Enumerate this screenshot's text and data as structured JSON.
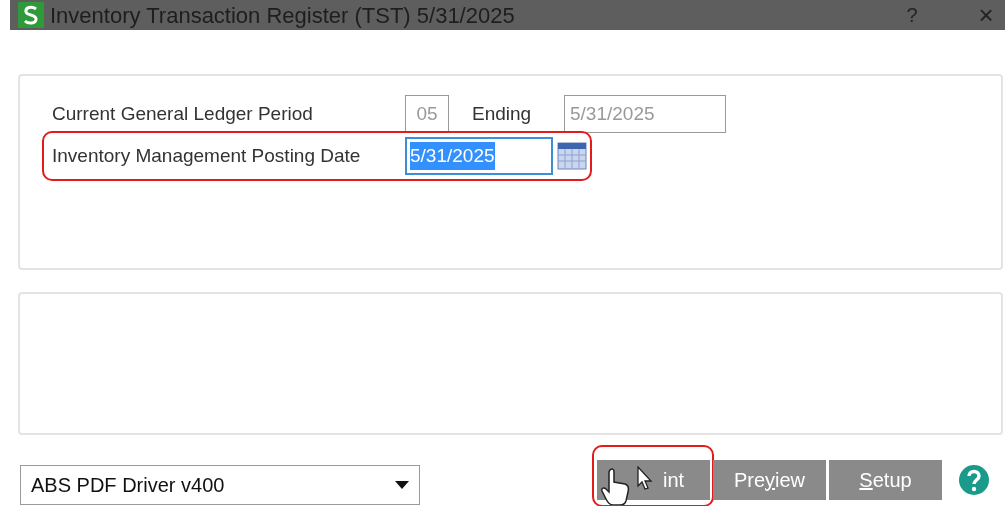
{
  "window": {
    "title": "Inventory Transaction Register (TST) 5/31/2025",
    "help": "?",
    "close": "×"
  },
  "fields": [
    {
      "kind": "period",
      "label": "Current General Ledger Period",
      "value": "05",
      "ending_label": "Ending",
      "ending_value": "5/31/2025"
    },
    {
      "kind": "date",
      "label": "Inventory Management Posting Date",
      "value": "5/31/2025",
      "selected": true,
      "highlight": true
    }
  ],
  "printer": {
    "value": "ABS PDF Driver v400"
  },
  "buttons": [
    {
      "after": "int",
      "highlight": true,
      "cursor": true
    },
    {
      "before": "Pre",
      "key": "y",
      "after": "iew"
    },
    {
      "key": "S",
      "after": "etup"
    }
  ]
}
